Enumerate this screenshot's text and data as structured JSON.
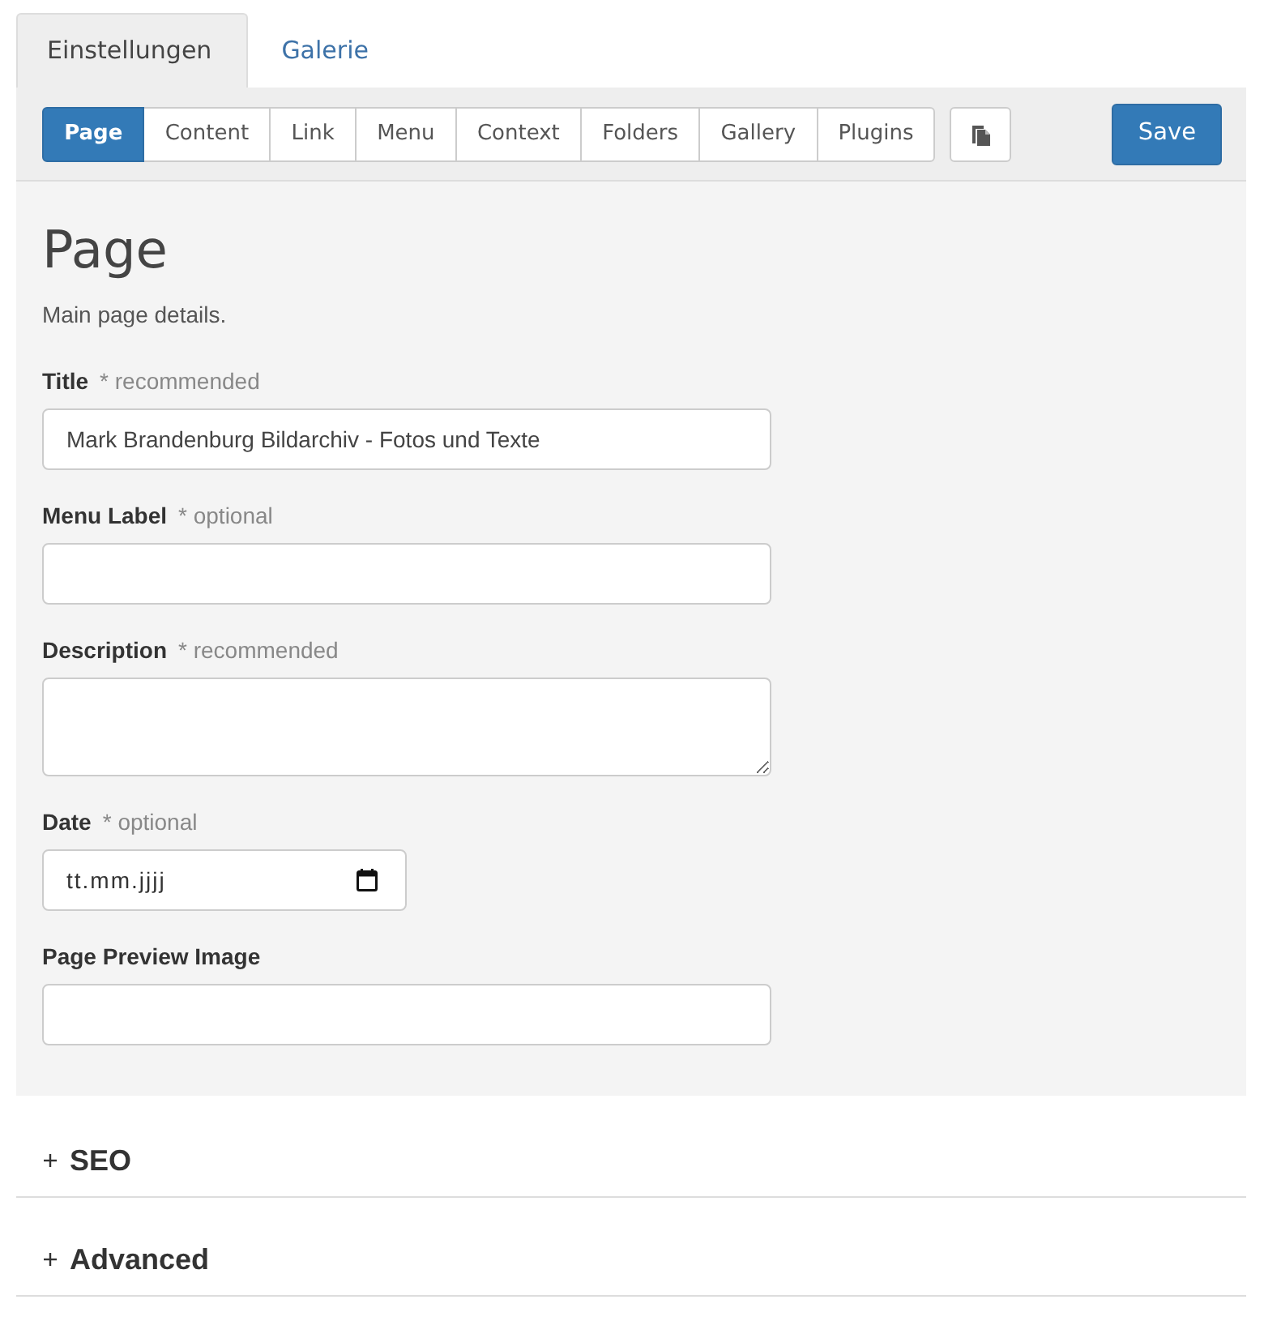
{
  "tabs": [
    {
      "label": "Einstellungen",
      "selected": true
    },
    {
      "label": "Galerie",
      "selected": false
    }
  ],
  "toolbar": {
    "section_buttons": [
      {
        "label": "Page",
        "selected": true
      },
      {
        "label": "Content",
        "selected": false
      },
      {
        "label": "Link",
        "selected": false
      },
      {
        "label": "Menu",
        "selected": false
      },
      {
        "label": "Context",
        "selected": false
      },
      {
        "label": "Folders",
        "selected": false
      },
      {
        "label": "Gallery",
        "selected": false
      },
      {
        "label": "Plugins",
        "selected": false
      }
    ],
    "save_label": "Save"
  },
  "panel": {
    "heading": "Page",
    "description": "Main page details.",
    "fields": [
      {
        "kind": "text",
        "label": "Title",
        "note": "* recommended",
        "value": "Mark Brandenburg Bildarchiv - Fotos und Texte"
      },
      {
        "kind": "text",
        "label": "Menu Label",
        "note": "* optional"
      },
      {
        "kind": "textarea",
        "label": "Description",
        "note": "* recommended"
      },
      {
        "kind": "date",
        "label": "Date",
        "note": "* optional",
        "placeholder": "tt.mm.jjjj"
      },
      {
        "kind": "text",
        "label": "Page Preview Image"
      }
    ]
  },
  "sections": [
    {
      "label": "SEO",
      "expanded": false
    },
    {
      "label": "Advanced",
      "expanded": false
    }
  ]
}
